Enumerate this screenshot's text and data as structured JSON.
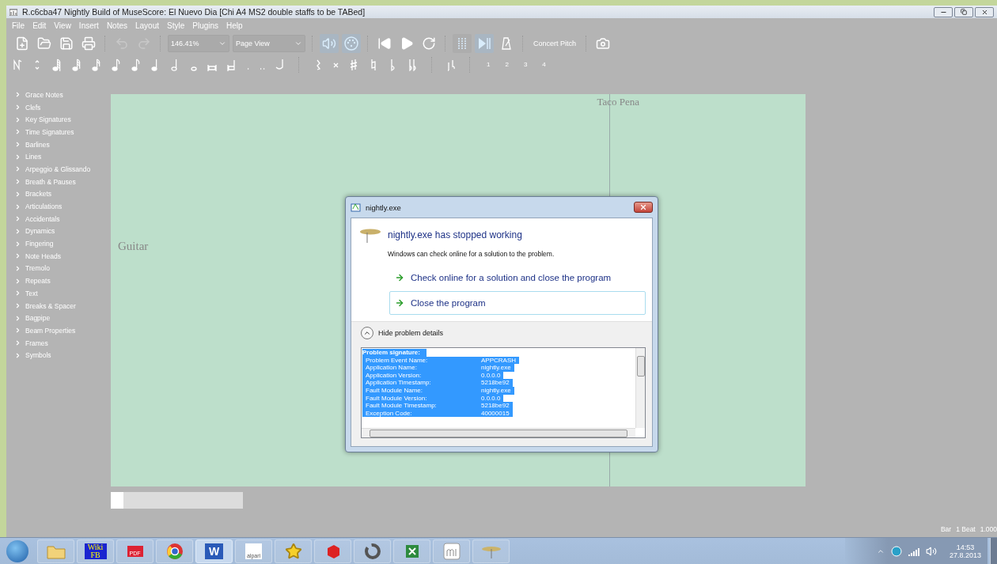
{
  "window": {
    "title": "R.c6cba47 Nightly Build of MuseScore: El Nuevo Dia [Chi A4 MS2 double staffs to be TABed]"
  },
  "menu": [
    "File",
    "Edit",
    "View",
    "Insert",
    "Notes",
    "Layout",
    "Style",
    "Plugins",
    "Help"
  ],
  "toolbar": {
    "zoom": "146.41%",
    "view": "Page View",
    "concert_pitch": "Concert Pitch",
    "sound_on": true,
    "midi_input_on": true,
    "loop_in_on": false,
    "loop_out_on": true
  },
  "voices": [
    "1",
    "2",
    "3",
    "4"
  ],
  "palette": [
    {
      "label": "Grace Notes"
    },
    {
      "label": "Clefs"
    },
    {
      "label": "Key Signatures"
    },
    {
      "label": "Time Signatures"
    },
    {
      "label": "Barlines"
    },
    {
      "label": "Lines"
    },
    {
      "label": "Arpeggio & Glissando"
    },
    {
      "label": "Breath & Pauses"
    },
    {
      "label": "Brackets"
    },
    {
      "label": "Articulations"
    },
    {
      "label": "Accidentals"
    },
    {
      "label": "Dynamics"
    },
    {
      "label": "Fingering"
    },
    {
      "label": "Note Heads"
    },
    {
      "label": "Tremolo"
    },
    {
      "label": "Repeats"
    },
    {
      "label": "Text"
    },
    {
      "label": "Breaks & Spacer"
    },
    {
      "label": "Bagpipe"
    },
    {
      "label": "Beam Properties"
    },
    {
      "label": "Frames"
    },
    {
      "label": "Symbols"
    }
  ],
  "score": {
    "composer": "Taco Pena",
    "instrument": "Guitar"
  },
  "status_bar": [
    "Bar",
    "1 Beat",
    "1.000"
  ],
  "dialog": {
    "title": "nightly.exe",
    "heading": "nightly.exe has stopped working",
    "message": "Windows can check online for a solution to the problem.",
    "options": [
      {
        "label": "Check online for a solution and close the program",
        "focused": false
      },
      {
        "label": "Close the program",
        "focused": true
      }
    ],
    "details_toggle": {
      "label": "Hide problem details",
      "expanded": true
    },
    "details_header": "Problem signature:",
    "details": [
      {
        "name": "Problem Event Name:",
        "value": "APPCRASH"
      },
      {
        "name": "Application Name:",
        "value": "nightly.exe"
      },
      {
        "name": "Application Version:",
        "value": "0.0.0.0"
      },
      {
        "name": "Application Timestamp:",
        "value": "5218be92"
      },
      {
        "name": "Fault Module Name:",
        "value": "nightly.exe"
      },
      {
        "name": "Fault Module Version:",
        "value": "0.0.0.0"
      },
      {
        "name": "Fault Module Timestamp:",
        "value": "5218be92"
      },
      {
        "name": "Exception Code:",
        "value": "40000015"
      }
    ]
  },
  "taskbar": {
    "apps": [
      {
        "kind": "folder",
        "active": false
      },
      {
        "kind": "wiki",
        "label": "Wiki FB",
        "active": false
      },
      {
        "kind": "pdf",
        "label": "PDF",
        "active": false
      },
      {
        "kind": "chrome",
        "active": false
      },
      {
        "kind": "word",
        "label": "W",
        "active": true
      },
      {
        "kind": "alpari",
        "label": "alpari",
        "active": false
      },
      {
        "kind": "star",
        "active": false
      },
      {
        "kind": "sketch",
        "active": false
      },
      {
        "kind": "ring",
        "active": false
      },
      {
        "kind": "excel",
        "active": false
      },
      {
        "kind": "muse",
        "active": false
      },
      {
        "kind": "cymbal",
        "active": false
      }
    ],
    "time": "14:53",
    "date": "27.8.2013"
  }
}
